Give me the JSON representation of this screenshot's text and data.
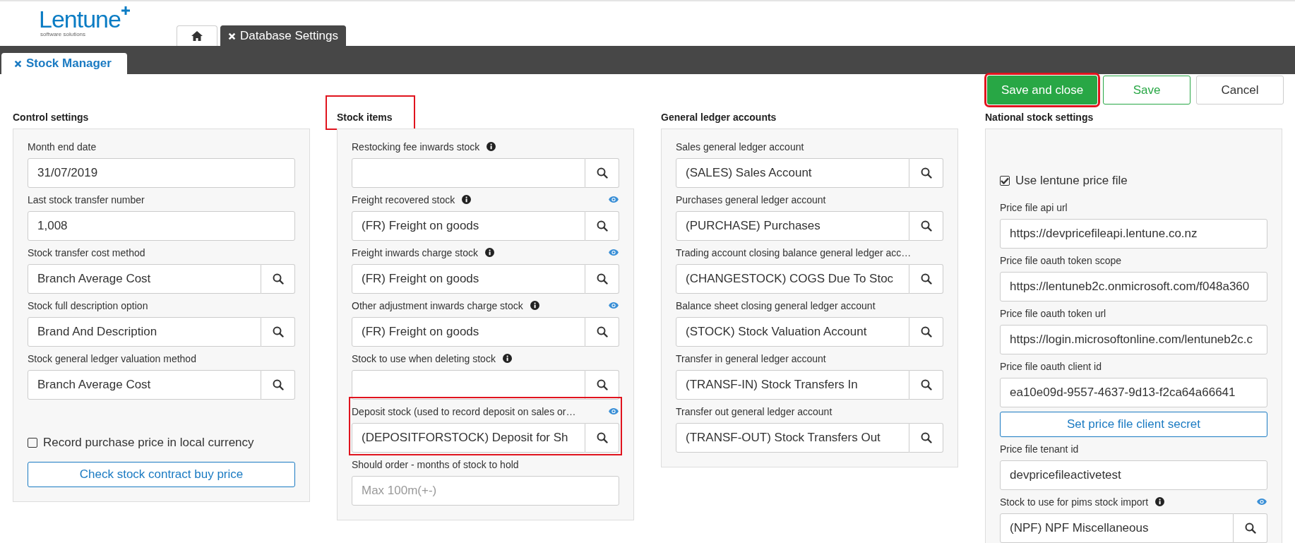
{
  "brand": {
    "name": "Lentune",
    "tagline": "software solutions"
  },
  "top_tabs": [
    {
      "kind": "home",
      "selected": false
    },
    {
      "kind": "text",
      "label": "Database Settings",
      "closable": true,
      "selected": true
    }
  ],
  "page_tab": {
    "label": "Stock Manager",
    "closable": true
  },
  "actions": [
    {
      "label": "Save and close",
      "kind": "primary",
      "highlighted": true
    },
    {
      "label": "Save",
      "kind": "outline",
      "highlighted": false
    },
    {
      "label": "Cancel",
      "kind": "plain",
      "highlighted": false
    }
  ],
  "sections": [
    {
      "title": "Control settings",
      "highlighted": false,
      "items": [
        {
          "kind": "text",
          "label": "Month end date",
          "value": "31/07/2019"
        },
        {
          "kind": "text",
          "label": "Last stock transfer number",
          "value": "1,008"
        },
        {
          "kind": "lookup",
          "label": "Stock transfer cost method",
          "value": "Branch Average Cost"
        },
        {
          "kind": "lookup",
          "label": "Stock full description option",
          "value": "Brand And Description"
        },
        {
          "kind": "lookup",
          "label": "Stock general ledger valuation method",
          "value": "Branch Average Cost"
        },
        {
          "kind": "spacer"
        },
        {
          "kind": "checkbox",
          "label": "Record purchase price in local currency",
          "checked": false
        },
        {
          "kind": "button",
          "label": "Check stock contract buy price"
        }
      ]
    },
    {
      "title": "Stock items",
      "highlighted": true,
      "items": [
        {
          "kind": "lookup",
          "label": "Restocking fee inwards stock",
          "info": true,
          "eye": false,
          "value": ""
        },
        {
          "kind": "lookup",
          "label": "Freight recovered stock",
          "info": true,
          "eye": true,
          "value": "(FR) Freight on goods"
        },
        {
          "kind": "lookup",
          "label": "Freight inwards charge stock",
          "info": true,
          "eye": true,
          "value": "(FR) Freight on goods"
        },
        {
          "kind": "lookup",
          "label": "Other adjustment inwards charge stock",
          "info": true,
          "eye": true,
          "value": "(FR) Freight on goods"
        },
        {
          "kind": "lookup",
          "label": "Stock to use when deleting stock",
          "info": true,
          "eye": false,
          "value": ""
        },
        {
          "kind": "lookup",
          "label": "Deposit stock (used to record deposit on sales or…",
          "info": false,
          "eye": true,
          "value": "(DEPOSITFORSTOCK) Deposit for Sh",
          "highlighted": true
        },
        {
          "kind": "text",
          "label": "Should order - months of stock to hold",
          "placeholder": "Max 100m(+-)"
        }
      ]
    },
    {
      "title": "General ledger accounts",
      "highlighted": false,
      "items": [
        {
          "kind": "lookup",
          "label": "Sales general ledger account",
          "value": "(SALES) Sales Account"
        },
        {
          "kind": "lookup",
          "label": "Purchases general ledger account",
          "value": "(PURCHASE) Purchases"
        },
        {
          "kind": "lookup",
          "label": "Trading account closing balance general ledger acc…",
          "value": "(CHANGESTOCK) COGS Due To Stoc"
        },
        {
          "kind": "lookup",
          "label": "Balance sheet closing general ledger account",
          "value": "(STOCK) Stock Valuation Account"
        },
        {
          "kind": "lookup",
          "label": "Transfer in general ledger account",
          "value": "(TRANSF-IN) Stock Transfers In"
        },
        {
          "kind": "lookup",
          "label": "Transfer out general ledger account",
          "value": "(TRANSF-OUT) Stock Transfers Out"
        }
      ]
    },
    {
      "title": "National stock settings",
      "highlighted": false,
      "items": [
        {
          "kind": "spacer"
        },
        {
          "kind": "checkbox",
          "label": "Use lentune price file",
          "checked": true
        },
        {
          "kind": "text",
          "label": "Price file api url",
          "value": "https://devpricefileapi.lentune.co.nz"
        },
        {
          "kind": "text",
          "label": "Price file oauth token scope",
          "value": "https://lentuneb2c.onmicrosoft.com/f048a360"
        },
        {
          "kind": "text",
          "label": "Price file oauth token url",
          "value": "https://login.microsoftonline.com/lentuneb2c.c"
        },
        {
          "kind": "text",
          "label": "Price file oauth client id",
          "value": "ea10e09d-9557-4637-9d13-f2ca64a66641"
        },
        {
          "kind": "button",
          "label": "Set price file client secret"
        },
        {
          "kind": "text",
          "label": "Price file tenant id",
          "value": "devpricefileactivetest"
        },
        {
          "kind": "lookup",
          "label": "Stock to use for pims stock import",
          "info": true,
          "eye": true,
          "value": "(NPF) NPF Miscellaneous"
        }
      ]
    }
  ]
}
